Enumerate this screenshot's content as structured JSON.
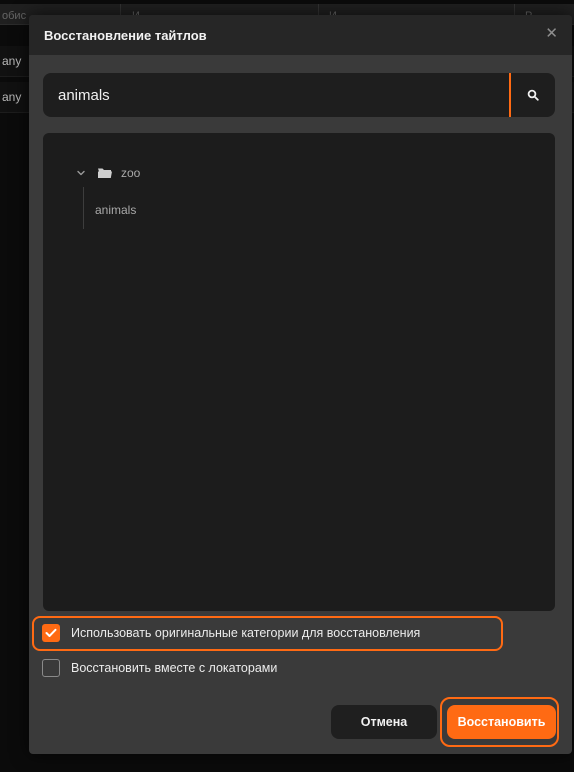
{
  "background": {
    "header_fragments": [
      "обис",
      "И",
      "И",
      "Р"
    ],
    "row_fragments": [
      "any",
      "any"
    ]
  },
  "modal": {
    "title": "Восстановление тайтлов",
    "close_icon": "close-icon"
  },
  "search": {
    "value": "animals",
    "placeholder": "",
    "icon": "search-icon"
  },
  "tree": {
    "folder": {
      "label": "zoo",
      "expanded": true,
      "icon": "folder-open-icon"
    },
    "children": [
      {
        "label": "animals"
      }
    ]
  },
  "options": {
    "use_original_categories": {
      "label": "Использовать оригинальные категории для восстановления",
      "checked": true
    },
    "restore_with_locators": {
      "label": "Восстановить вместе с локаторами",
      "checked": false
    }
  },
  "buttons": {
    "cancel_label": "Отмена",
    "restore_label": "Восстановить"
  },
  "colors": {
    "accent": "#ff6a13",
    "modal_bg": "#3a3a3a",
    "panel_bg": "#1c1c1c",
    "header_bg": "#262626"
  }
}
